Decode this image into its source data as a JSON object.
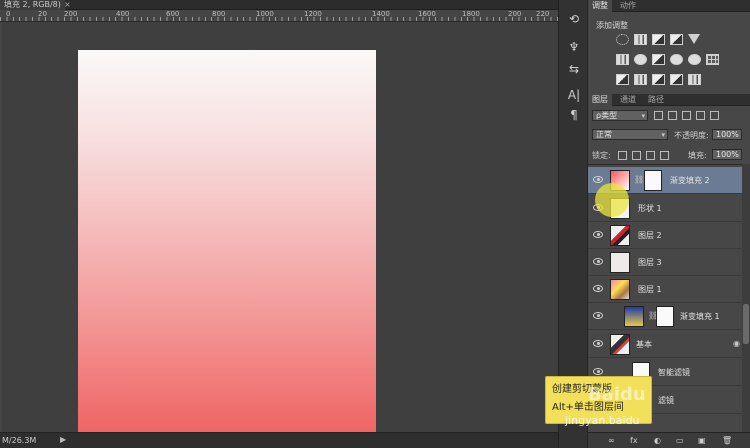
{
  "document": {
    "tab_title": "填充 2, RGB/8)",
    "tab_close": "×",
    "status_size": "M/26.3M",
    "status_arrow": "▶",
    "ruler_labels": [
      "0",
      "20",
      "200",
      "400",
      "600",
      "800",
      "1000",
      "1200",
      "1400",
      "1600",
      "1800",
      "200",
      "220"
    ]
  },
  "dock": {
    "items": [
      "history-icon",
      "brush-preset-icon",
      "tool-preset-icon",
      "character-icon",
      "paragraph-icon"
    ],
    "glyphs": [
      "⟲",
      "♆",
      "⇆",
      "A|",
      "¶"
    ]
  },
  "adjustments": {
    "tabs": [
      "调整",
      "动作"
    ],
    "title": "添加调整"
  },
  "layers": {
    "tabs": [
      "图层",
      "通道",
      "路径"
    ],
    "filter_kind": "ρ类型",
    "blend_mode": "正常",
    "opacity_label": "不透明度:",
    "opacity_value": "100%",
    "lock_label": "锁定:",
    "fill_label": "填充:",
    "fill_value": "100%",
    "rows": [
      {
        "name": "渐变填充 2"
      },
      {
        "name": "形状 1"
      },
      {
        "name": "图层 2"
      },
      {
        "name": "图层 3"
      },
      {
        "name": "图层 1"
      },
      {
        "name": "渐变填充 1"
      },
      {
        "name": "基本"
      },
      {
        "name": "智能滤镜"
      },
      {
        "name": "滤镜"
      }
    ],
    "bottom_icons": [
      "∞",
      "fx",
      "◐",
      "▭",
      "▣",
      "🗑"
    ]
  },
  "tooltip": {
    "line1": "创建剪切蒙版",
    "line2": "Alt+单击图层间"
  },
  "watermark": {
    "logo": "Baidu",
    "url": "jingyan.baidu"
  }
}
